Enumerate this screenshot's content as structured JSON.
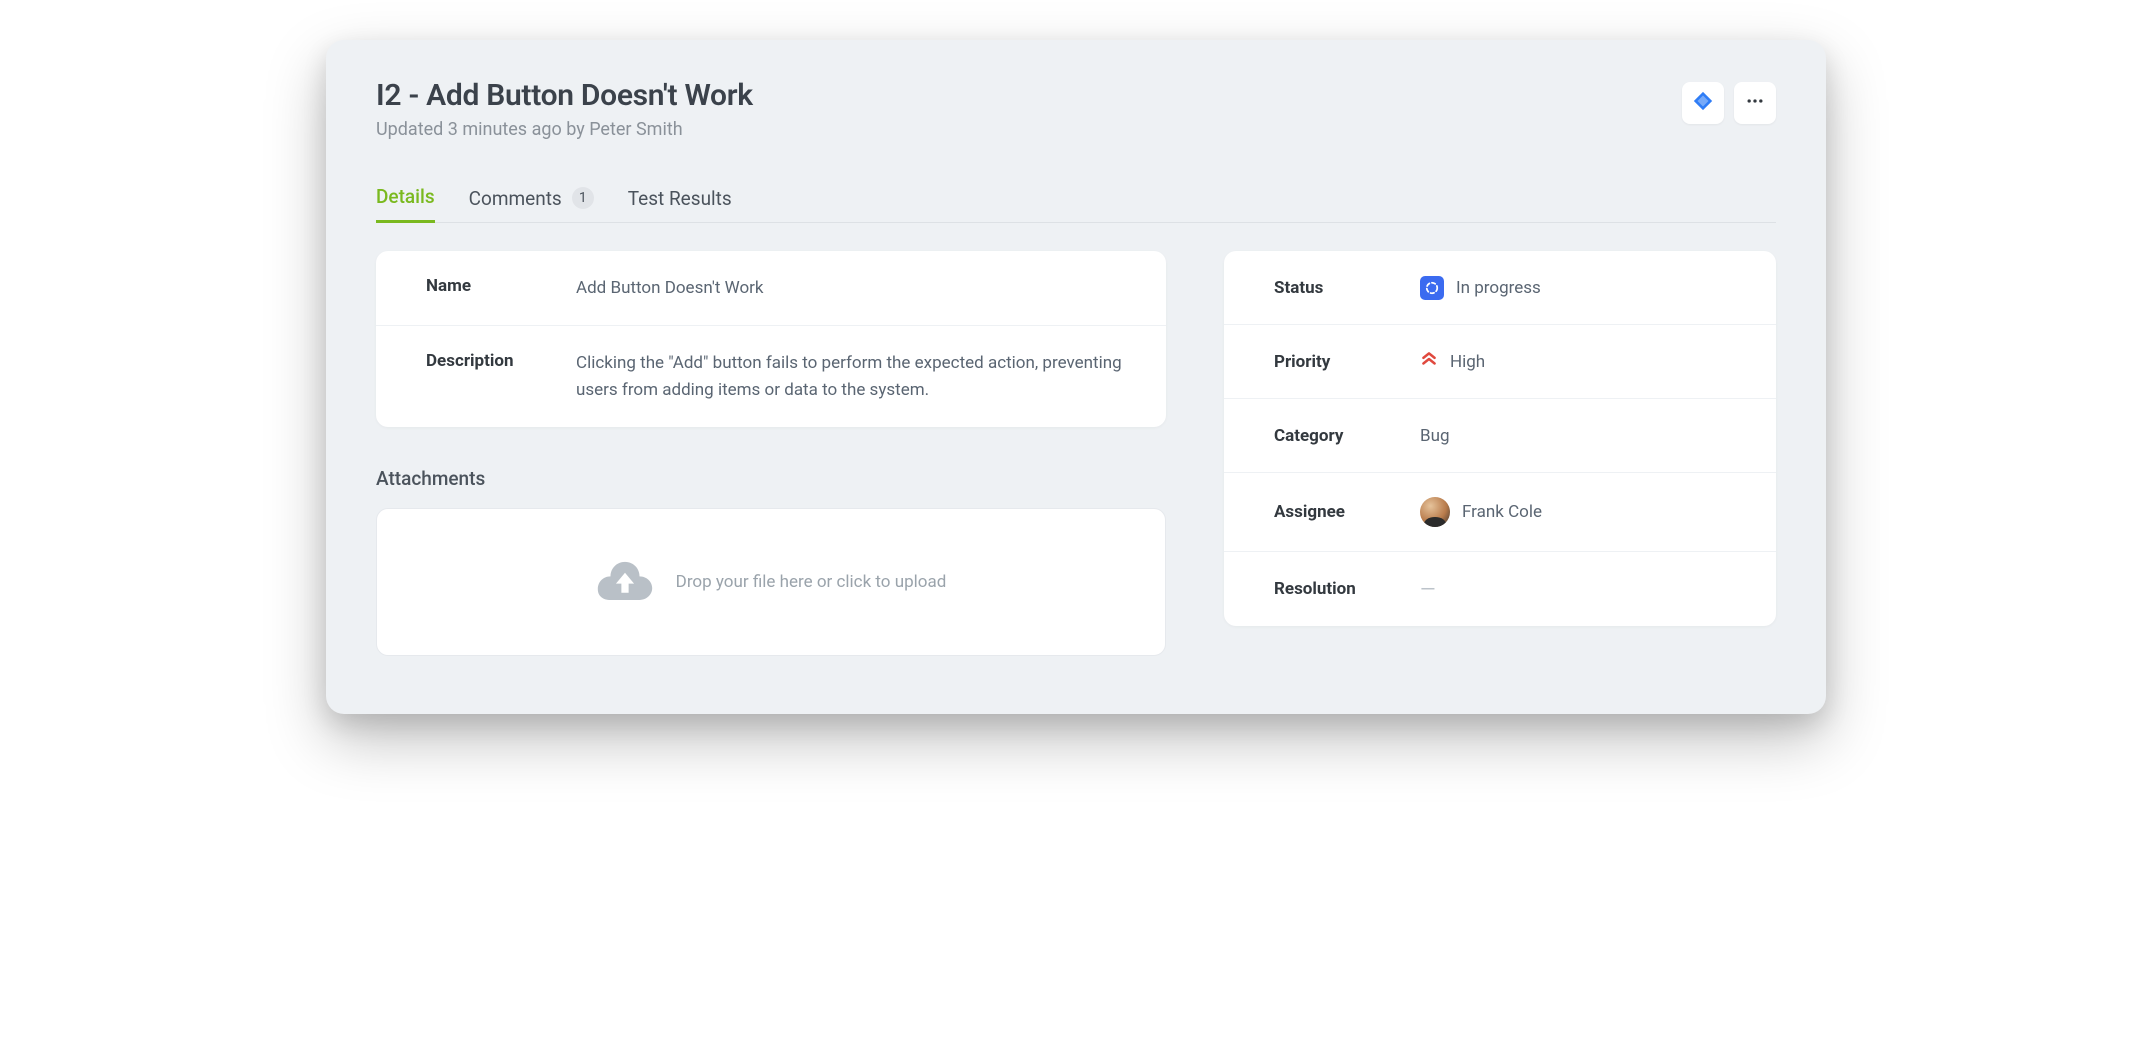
{
  "header": {
    "title": "I2 - Add Button Doesn't Work",
    "subtitle": "Updated 3 minutes ago by Peter Smith"
  },
  "tabs": {
    "details": "Details",
    "comments": "Comments",
    "comments_count": "1",
    "test_results": "Test Results"
  },
  "details": {
    "name_label": "Name",
    "name_value": "Add Button Doesn't Work",
    "description_label": "Description",
    "description_value": "Clicking the \"Add\" button fails to perform the expected action, preventing users from adding items or data to the system."
  },
  "attachments": {
    "title": "Attachments",
    "dropzone_text": "Drop your file here or click to upload"
  },
  "meta": {
    "status_label": "Status",
    "status_value": "In progress",
    "priority_label": "Priority",
    "priority_value": "High",
    "category_label": "Category",
    "category_value": "Bug",
    "assignee_label": "Assignee",
    "assignee_value": "Frank Cole",
    "resolution_label": "Resolution",
    "resolution_value": "—"
  }
}
